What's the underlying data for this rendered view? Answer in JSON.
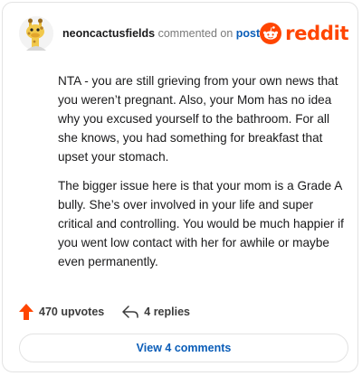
{
  "header": {
    "username": "neoncactusfields",
    "action_text": "commented on",
    "target_text": "post",
    "brand": "reddit"
  },
  "comment": {
    "paragraphs": [
      "NTA - you are still grieving from your own news that you weren’t pregnant. Also, your Mom has no idea why you excused yourself to the bathroom. For all she knows, you had something for breakfast that upset your stomach.",
      "The bigger issue here is that your mom is a Grade A bully. She’s over involved in your life and super critical and controlling. You would be much happier if you went low contact with her for awhile or maybe even permanently."
    ]
  },
  "actions": {
    "upvotes": "470 upvotes",
    "replies": "4 replies"
  },
  "footer": {
    "view_comments": "View 4 comments"
  },
  "icons": {
    "upvote": "upvote-arrow-icon",
    "reply": "reply-arrow-icon",
    "brand": "reddit-snoo-icon",
    "avatar": "giraffe-avatar-icon"
  },
  "colors": {
    "brand": "#ff4500",
    "link": "#0a5db8",
    "text": "#1a1a1b",
    "muted": "#7a7a7a"
  }
}
